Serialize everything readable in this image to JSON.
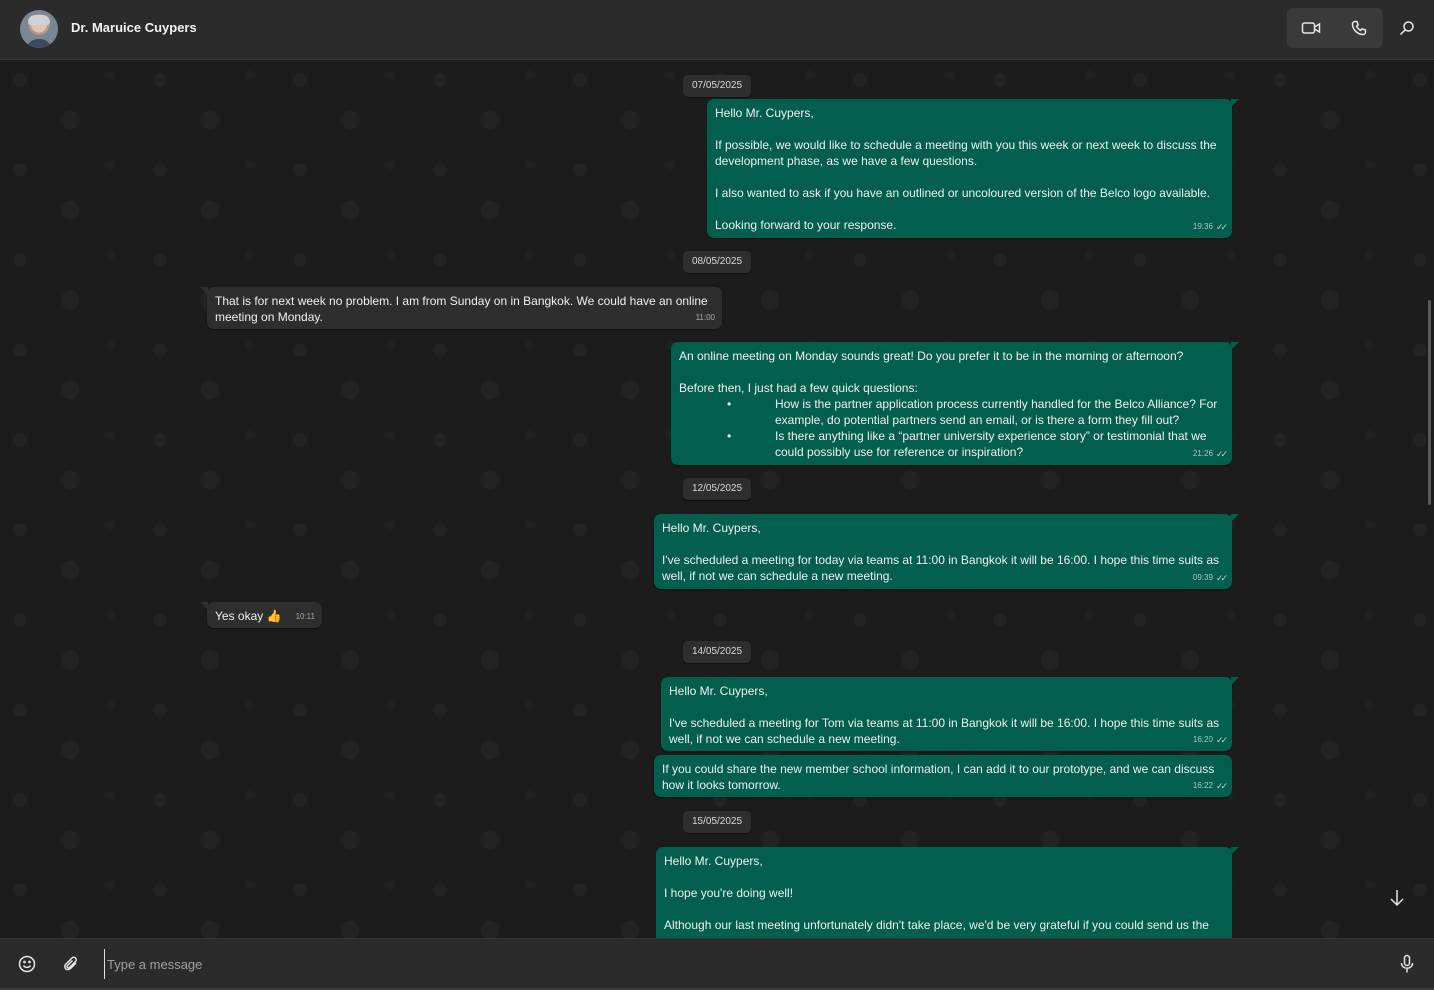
{
  "header": {
    "contact_name": "Dr. Maruice Cuypers",
    "video_icon": "video-camera-icon",
    "phone_icon": "phone-icon",
    "search_icon": "search-icon"
  },
  "messages": [
    {
      "type": "date",
      "text": "07/05/2025"
    },
    {
      "type": "out",
      "time": "19:36",
      "text": "Hello Mr. Cuypers,\n\nIf possible, we would like to schedule a meeting with you this week or next week to discuss the development phase, as we have a few questions.\n\nI also wanted to ask if you have an outlined or uncoloured version of the Belco logo available.\n\nLooking forward to your response."
    },
    {
      "type": "date",
      "text": "08/05/2025"
    },
    {
      "type": "in",
      "time": "11:00",
      "text": "That is for next week no problem. I am from Sunday on in Bangkok. We could have an online meeting on Monday."
    },
    {
      "type": "out",
      "time": "21:26",
      "intro": "An online meeting on Monday sounds great! Do you prefer it to be in the morning or afternoon?\n\nBefore then, I just had a few quick questions:",
      "bullets": [
        "How is the partner application process currently handled for the Belco Alliance? For example, do potential partners send an email, or is there a form they fill out?",
        "Is there anything like a “partner university experience story” or testimonial that we could possibly use for reference or inspiration?"
      ],
      "bullet_char": "•"
    },
    {
      "type": "date",
      "text": "12/05/2025"
    },
    {
      "type": "out",
      "time": "09:39",
      "text": "Hello Mr. Cuypers,\n\nI've scheduled a meeting for today via teams at 11:00 in Bangkok it will be 16:00. I hope this time suits as well, if not we can schedule a new meeting."
    },
    {
      "type": "in",
      "time": "10:11",
      "text": "Yes okay 👍"
    },
    {
      "type": "date",
      "text": "14/05/2025"
    },
    {
      "type": "out",
      "time": "16:20",
      "text": "Hello Mr. Cuypers,\n\nI've scheduled a meeting for Tom via teams at 11:00 in Bangkok it will be 16:00. I hope this time suits as well, if not we can schedule a new meeting."
    },
    {
      "type": "out",
      "time": "16:22",
      "text": "If you could share the new member school information, I can add it to our prototype, and we can discuss how it looks tomorrow."
    },
    {
      "type": "date",
      "text": "15/05/2025"
    },
    {
      "type": "out",
      "time": "",
      "text": "Hello Mr. Cuypers,\n\nI hope you're doing well!\n\nAlthough our last meeting unfortunately didn't take place, we'd be very grateful if you could send us the"
    }
  ],
  "composer": {
    "placeholder": "Type a message",
    "emoji_icon": "emoji-icon",
    "attach_icon": "paperclip-icon",
    "mic_icon": "microphone-icon"
  },
  "colors": {
    "outgoing_bubble": "#025e4d",
    "incoming_bubble": "#2e2e2e",
    "background": "#1c1c1c"
  }
}
